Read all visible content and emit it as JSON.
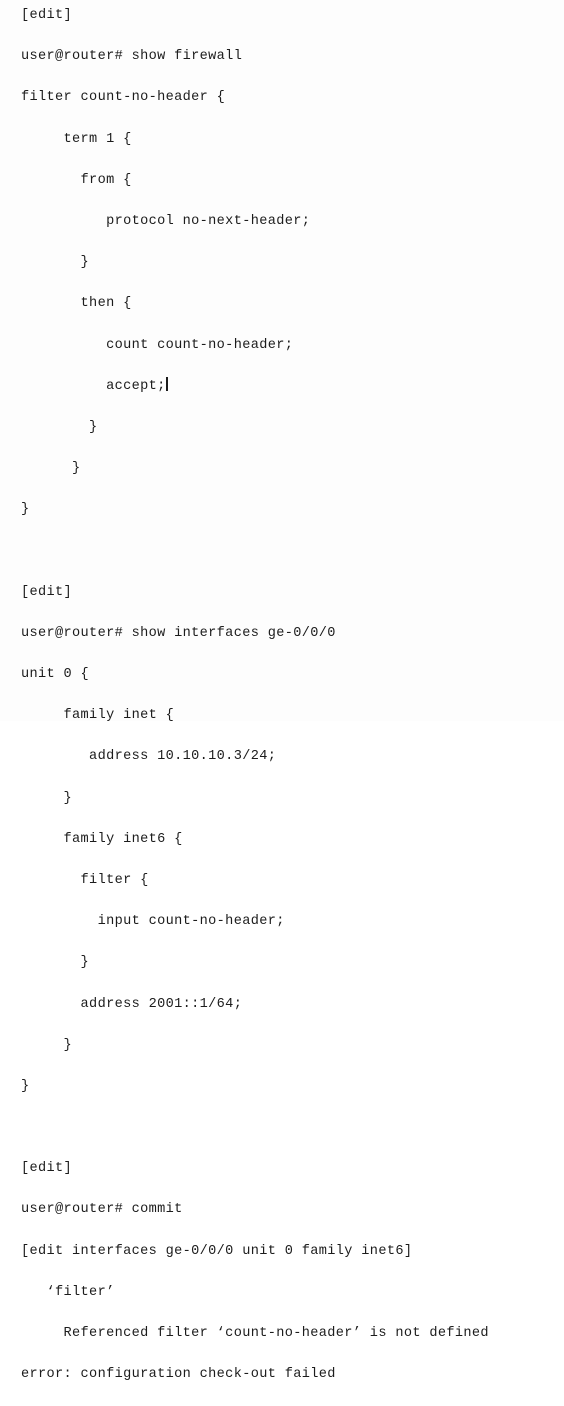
{
  "terminal": {
    "device": "router",
    "user": "user",
    "prompt_symbol": "#",
    "background_color": "#fdfdfd",
    "text_color": "#1c1c1c",
    "watermark_text": "",
    "cursor": {
      "visible": true,
      "after_line_index": 9
    },
    "lines": [
      {
        "text": "[edit]"
      },
      {
        "text": "user@router# show firewall"
      },
      {
        "text": "filter count-no-header {"
      },
      {
        "text": "     term 1 {"
      },
      {
        "text": "       from {"
      },
      {
        "text": "          protocol no-next-header;"
      },
      {
        "text": "       }"
      },
      {
        "text": "       then {"
      },
      {
        "text": "          count count-no-header;"
      },
      {
        "text": "          accept;",
        "cursor": true
      },
      {
        "text": "        }"
      },
      {
        "text": "      }"
      },
      {
        "text": "}"
      },
      {
        "text": ""
      },
      {
        "text": "[edit]"
      },
      {
        "text": "user@router# show interfaces ge-0/0/0"
      },
      {
        "text": "unit 0 {"
      },
      {
        "text": "     family inet {"
      },
      {
        "text": "        address 10.10.10.3/24;"
      },
      {
        "text": "     }"
      },
      {
        "text": "     family inet6 {"
      },
      {
        "text": "       filter {"
      },
      {
        "text": "         input count-no-header;"
      },
      {
        "text": "       }"
      },
      {
        "text": "       address 2001::1/64;"
      },
      {
        "text": "     }"
      },
      {
        "text": "}"
      },
      {
        "text": ""
      },
      {
        "text": "[edit]"
      },
      {
        "text": "user@router# commit"
      },
      {
        "text": "[edit interfaces ge-0/0/0 unit 0 family inet6]"
      },
      {
        "text": "   ‘filter’"
      },
      {
        "text": "     Referenced filter ‘count-no-header’ is not defined"
      },
      {
        "text": "error: configuration check-out failed"
      }
    ]
  }
}
